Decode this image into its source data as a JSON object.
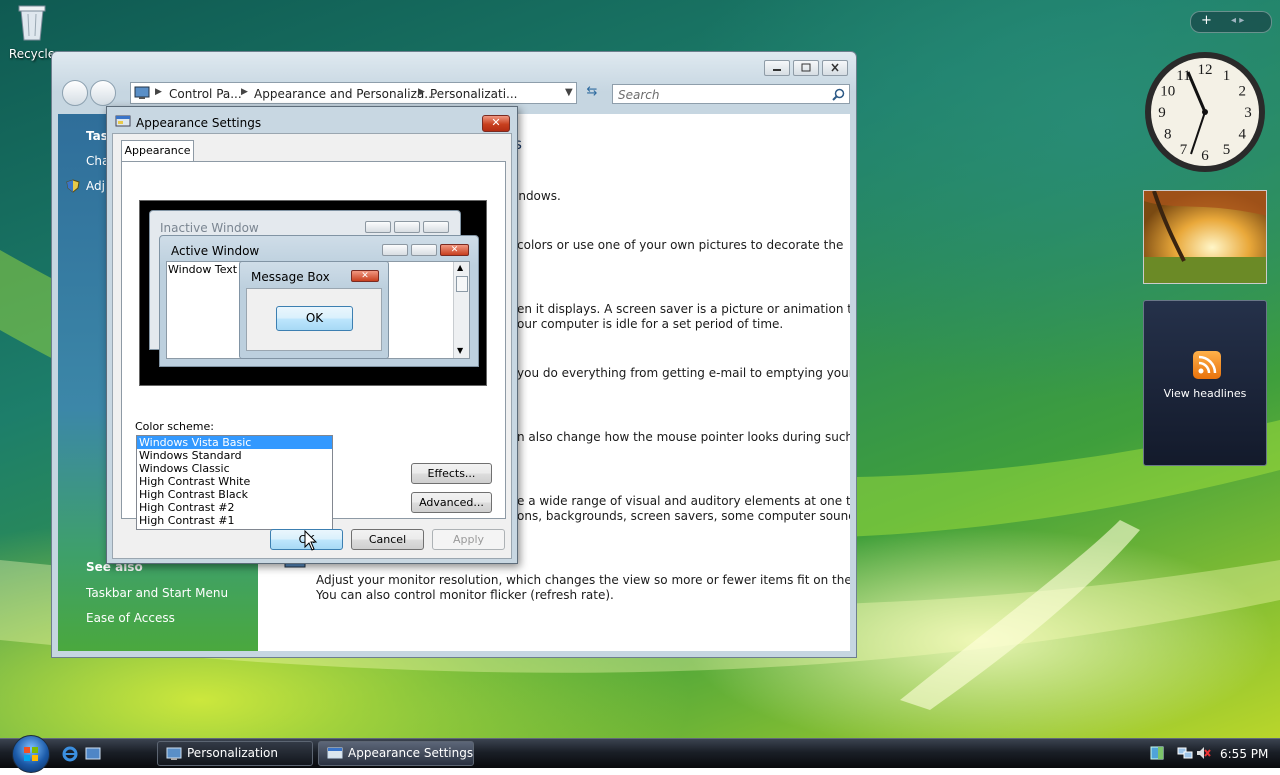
{
  "desktop": {
    "recycle_label": "Recycle",
    "sidebar_add": "+",
    "sidebar_nav": "◂ ▸",
    "feed_label": "View headlines"
  },
  "clock_face": [
    "12",
    "1",
    "2",
    "3",
    "4",
    "5",
    "6",
    "7",
    "8",
    "9",
    "10",
    "11"
  ],
  "control_panel": {
    "breadcrumbs": [
      "Control Pa...",
      "Appearance and Personaliza...",
      "Personalizati..."
    ],
    "search_placeholder": "Search",
    "left_pane": {
      "tasks_header": "Tas",
      "task_1": "Cha",
      "task_2": "Adj",
      "see_also": "See also",
      "link_1": "Taskbar and Start Menu",
      "link_2": "Ease of Access"
    },
    "main_pane": {
      "heading_fragment": "ls",
      "lines": [
        "indows.",
        "colors or use one of your own pictures to decorate the",
        "en it displays. A screen saver is a picture or animation that",
        "our computer is idle for a set period of time.",
        "you do everything from getting e-mail to emptying your",
        "n also change how the mouse pointer looks during such",
        "e a wide range of visual and auditory elements at one time",
        "ons, backgrounds, screen savers, some computer sounds,",
        "Adjust your monitor resolution, which changes the view so more or fewer items fit on the screen.",
        "You can also control monitor flicker (refresh rate)."
      ]
    }
  },
  "dialog": {
    "title": "Appearance Settings",
    "close_label": "✕",
    "tab_label": "Appearance",
    "preview": {
      "inactive_title": "Inactive Window",
      "active_title": "Active Window",
      "window_text": "Window Text",
      "message_title": "Message Box",
      "message_ok": "OK"
    },
    "color_scheme_label": "Color scheme:",
    "color_schemes": [
      "Windows Vista Basic",
      "Windows Standard",
      "Windows Classic",
      "High Contrast White",
      "High Contrast Black",
      "High Contrast #2",
      "High Contrast #1"
    ],
    "selected_scheme": "Windows Vista Basic",
    "effects_label": "Effects...",
    "advanced_label": "Advanced...",
    "ok_label": "OK",
    "cancel_label": "Cancel",
    "apply_label": "Apply"
  },
  "taskbar": {
    "tasks": [
      "Personalization",
      "Appearance Settings"
    ],
    "time": "6:55 PM"
  },
  "colors": {
    "selection": "#3399ff",
    "close_red": "#c8401f",
    "left_pane_blue": "#2f6e9a",
    "left_pane_green": "#4aa83e"
  }
}
